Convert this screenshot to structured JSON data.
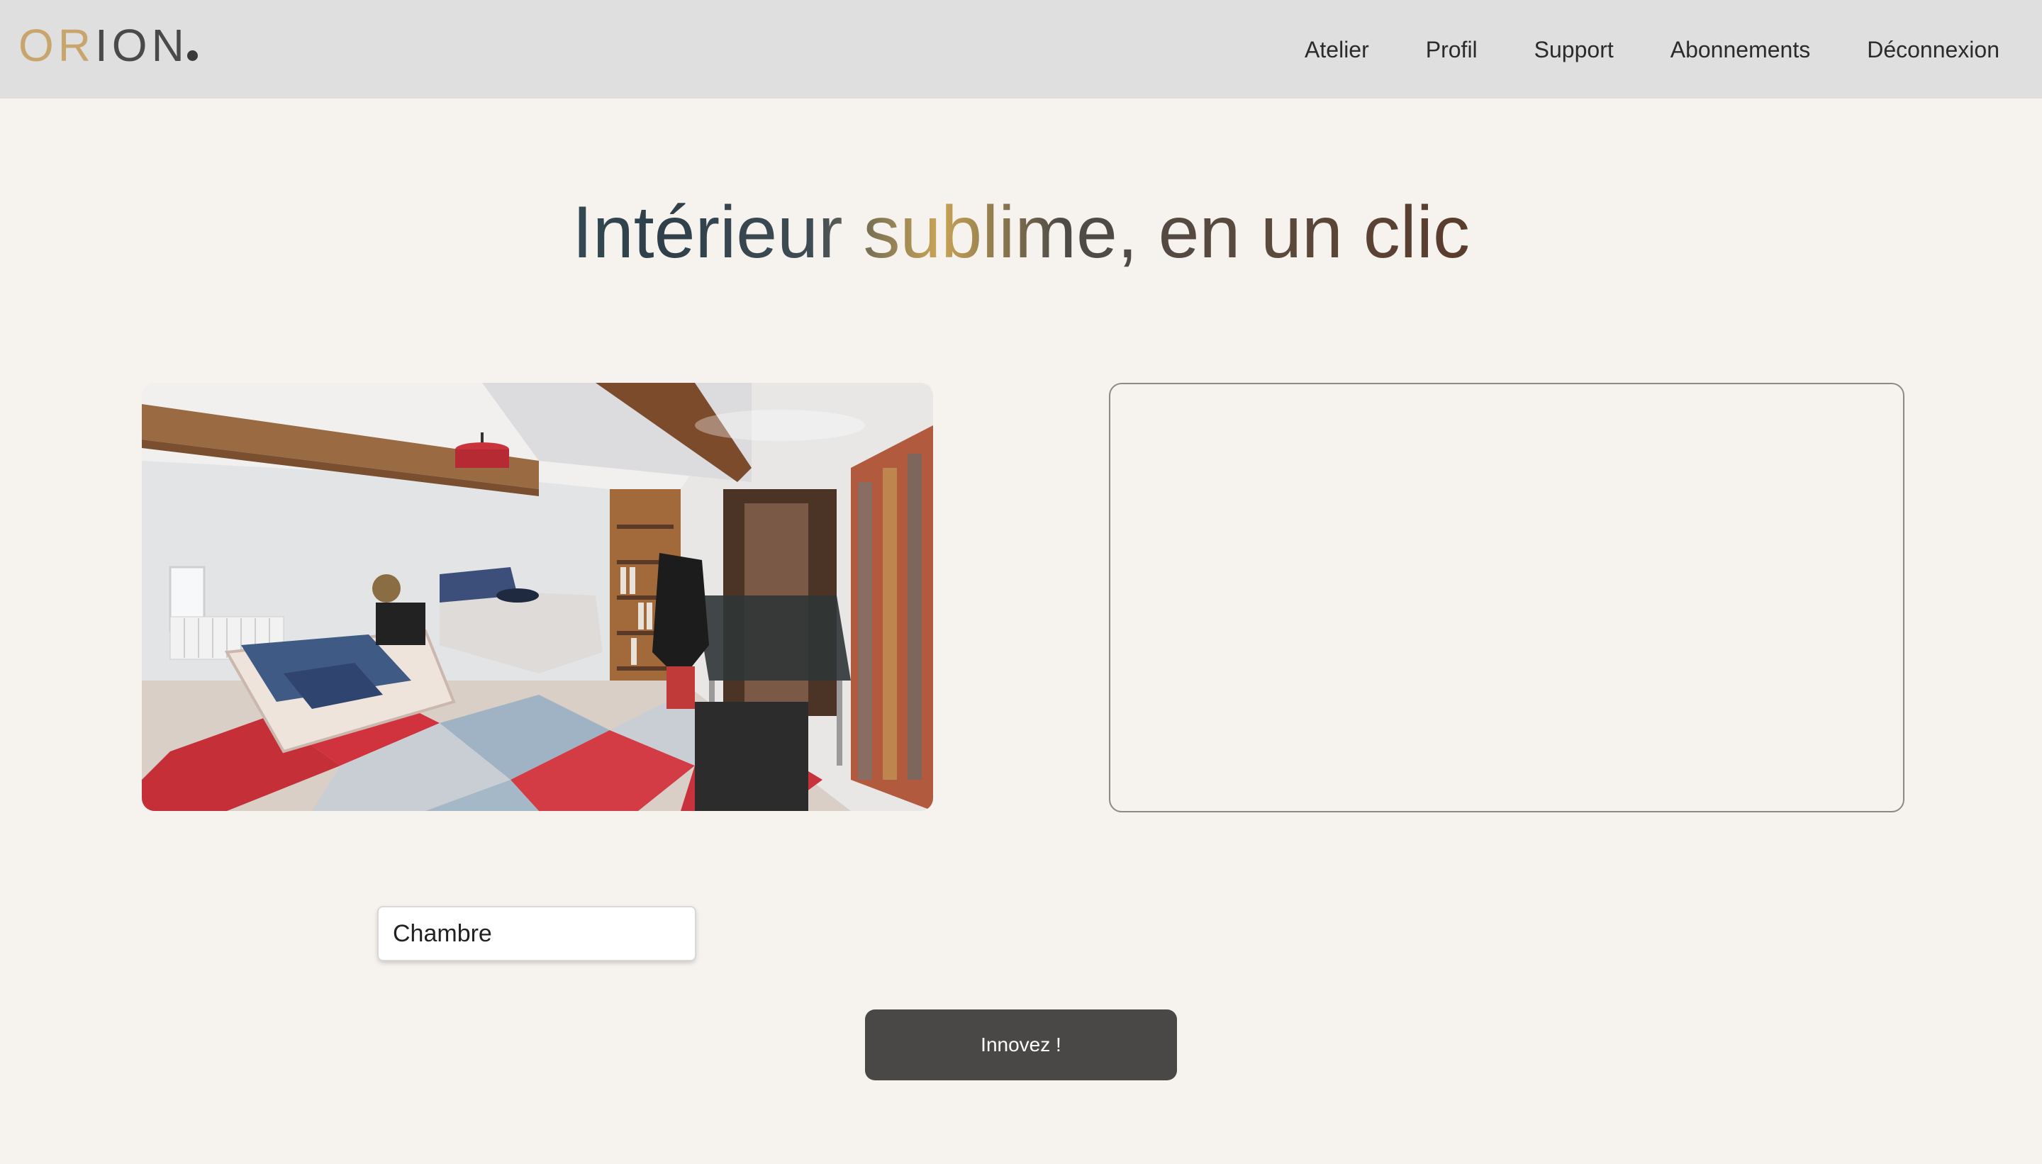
{
  "brand": {
    "logo_text_gold": "OR",
    "logo_text_dark": "ION"
  },
  "nav": {
    "items": [
      {
        "label": "Atelier"
      },
      {
        "label": "Profil"
      },
      {
        "label": "Support"
      },
      {
        "label": "Abonnements"
      },
      {
        "label": "Déconnexion"
      }
    ]
  },
  "hero": {
    "title": "Intérieur sublime, en un clic"
  },
  "form": {
    "room_type_value": "Chambre",
    "submit_label": "Innovez !"
  },
  "colors": {
    "header_bg": "#dfdfdf",
    "page_bg": "#f6f2ee",
    "logo_gold": "#c8a56c",
    "button_bg": "#4a4847"
  },
  "images": {
    "source_photo": "bedroom-photo"
  }
}
